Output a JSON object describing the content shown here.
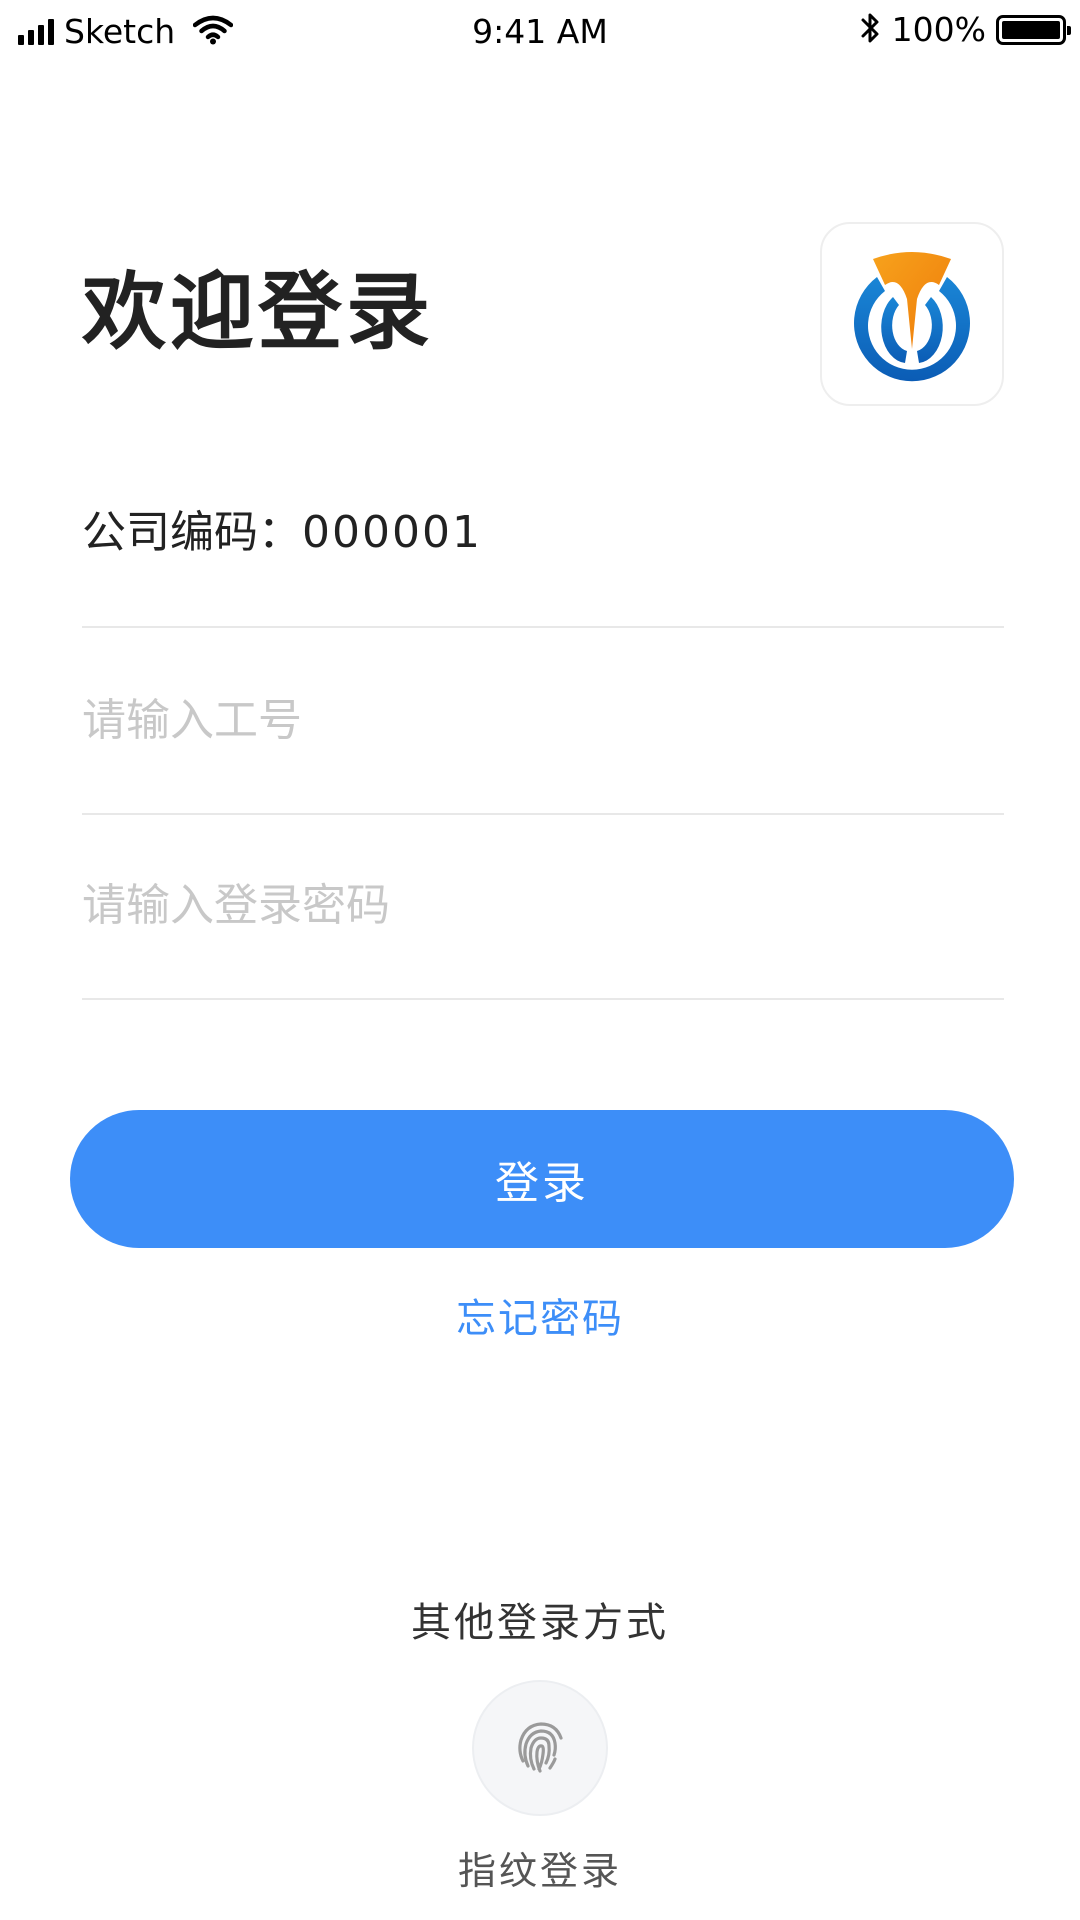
{
  "status_bar": {
    "carrier": "Sketch",
    "time": "9:41 AM",
    "battery_percent": "100%",
    "icons": [
      "signal-icon",
      "wifi-icon",
      "bluetooth-icon",
      "battery-icon"
    ]
  },
  "header": {
    "title": "欢迎登录",
    "logo_icon": "app-logo-icon"
  },
  "form": {
    "company_label": "公司编码：",
    "company_code": "000001",
    "employee_placeholder": "请输入工号",
    "employee_value": "",
    "password_placeholder": "请输入登录密码",
    "password_value": ""
  },
  "actions": {
    "login_label": "登录",
    "forgot_label": "忘记密码"
  },
  "other_login": {
    "title": "其他登录方式",
    "fingerprint_label": "指纹登录",
    "fingerprint_icon": "fingerprint-icon"
  },
  "colors": {
    "accent": "#3d8ef8",
    "placeholder": "#c8c8c8",
    "divider": "#e8e8e8"
  }
}
